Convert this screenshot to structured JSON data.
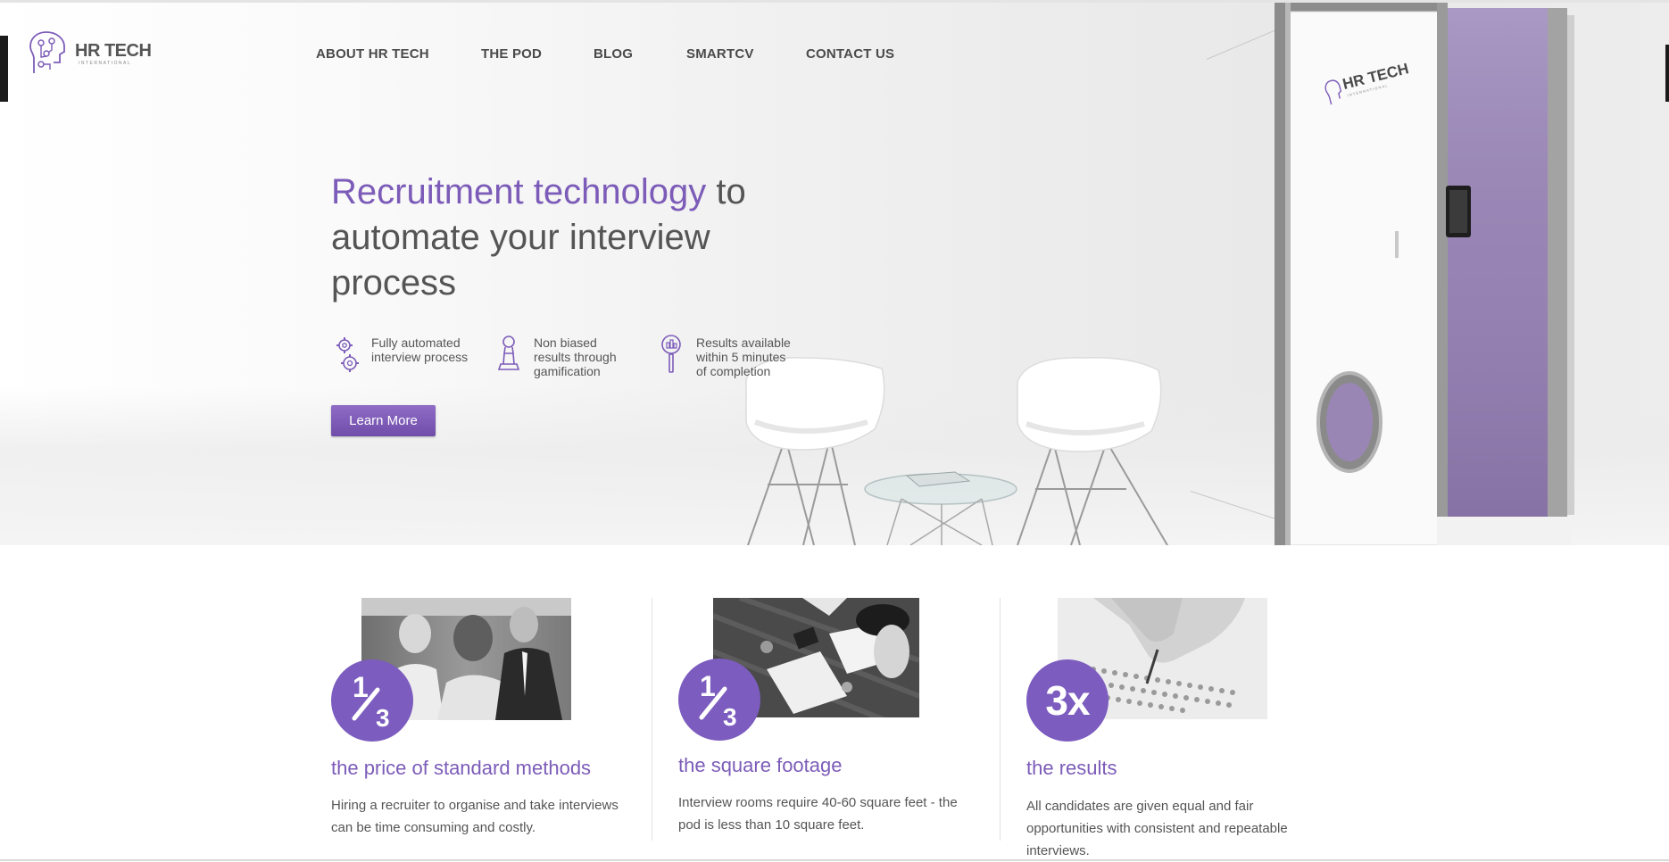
{
  "brand": {
    "name": "HR TECH",
    "sub": "INTERNATIONAL",
    "accent": "#7c5cb8"
  },
  "nav": {
    "items": [
      {
        "label": "ABOUT HR TECH"
      },
      {
        "label": "THE POD"
      },
      {
        "label": "BLOG"
      },
      {
        "label": "SMARTCV"
      },
      {
        "label": "CONTACT US"
      }
    ]
  },
  "hero": {
    "headline_accent": "Recruitment technology",
    "headline_rest": " to automate your interview process",
    "features": [
      {
        "icon": "gears-icon",
        "text": "Fully automated\ninterview process"
      },
      {
        "icon": "pawn-icon",
        "text": "Non biased\nresults through\ngamification"
      },
      {
        "icon": "magnifier-chart-icon",
        "text": "Results available\nwithin 5 minutes\nof completion"
      }
    ],
    "cta_label": "Learn More",
    "pod_brand": "HR TECH",
    "pod_sub": "INTERNATIONAL"
  },
  "stats": [
    {
      "badge_num": "1",
      "badge_den": "3",
      "title": "the price of standard methods",
      "desc": "Hiring a recruiter to organise and take interviews can be time consuming and costly.",
      "photo": "meeting-photo"
    },
    {
      "badge_num": "1",
      "badge_den": "3",
      "title": "the square footage",
      "desc": "Interview rooms require 40-60 square feet - the pod is less than 10 square feet.",
      "photo": "desk-photo"
    },
    {
      "badge": "3x",
      "title": "the results",
      "desc": "All candidates are given equal and fair opportunities with consistent and repeatable interviews.",
      "photo": "test-sheet-photo"
    }
  ]
}
